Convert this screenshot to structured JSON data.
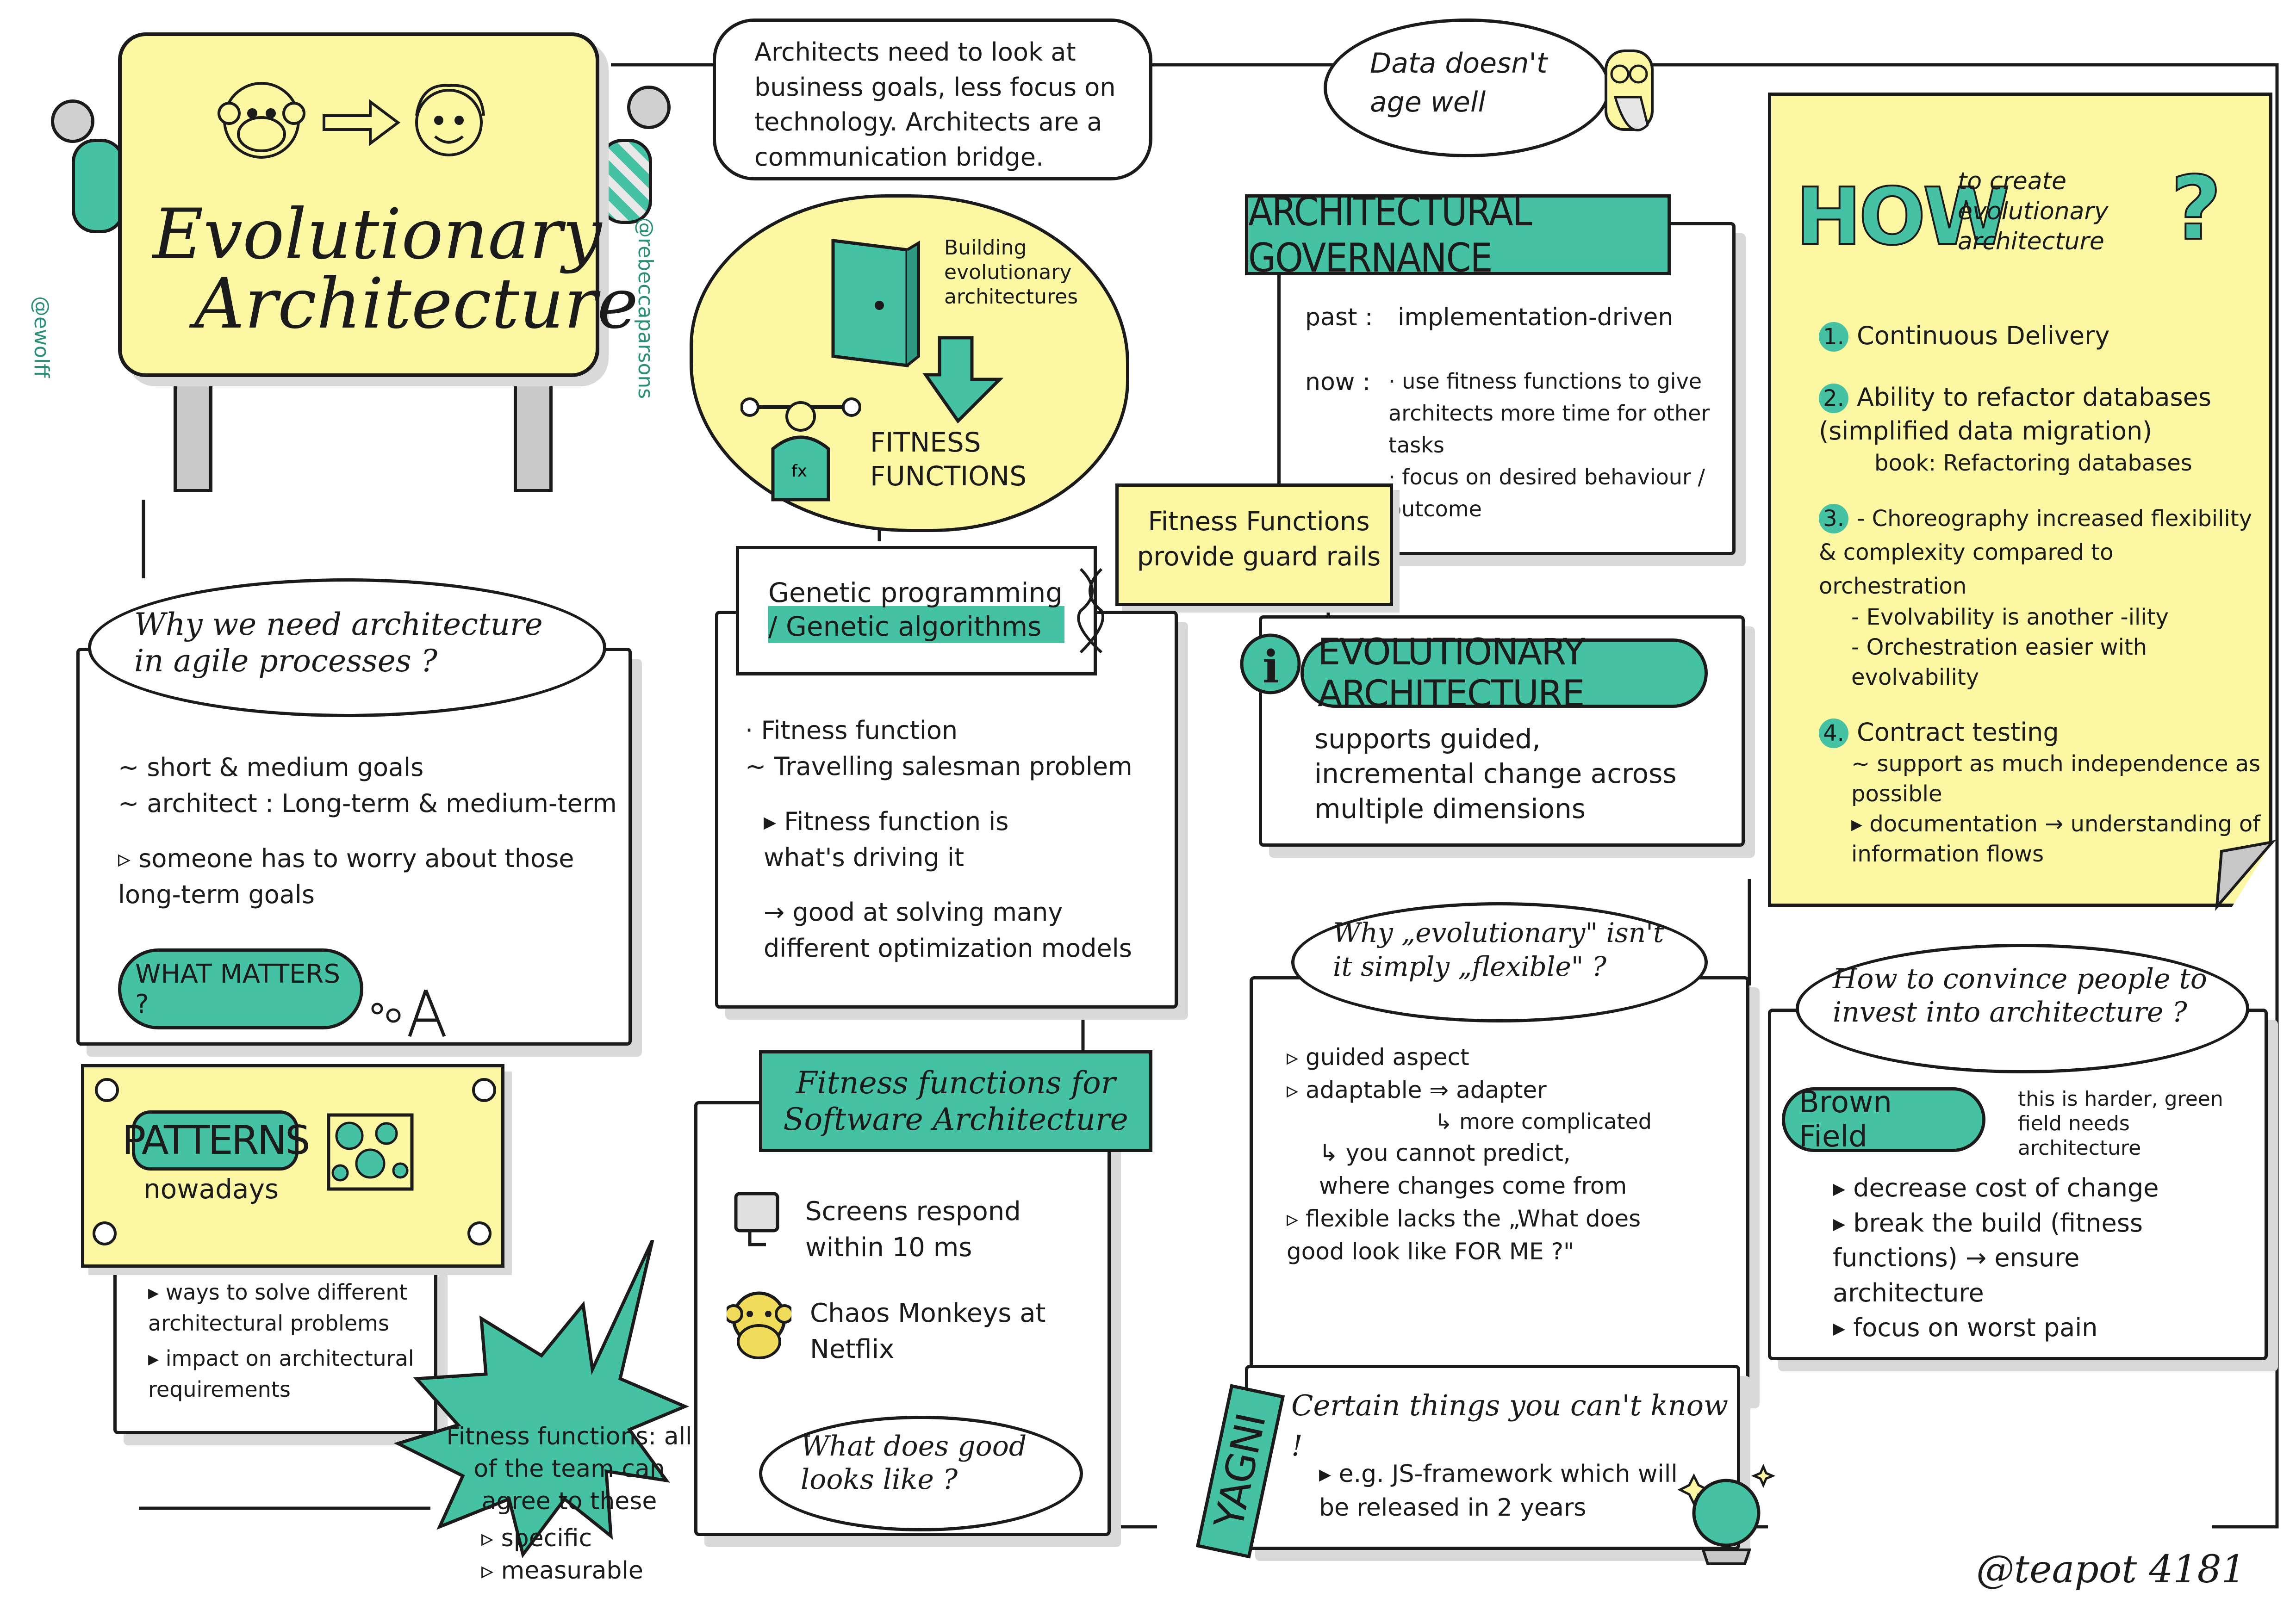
{
  "colors": {
    "teal": "#45c1a3",
    "yellow": "#fbf7a3",
    "ink": "#1b1b1b",
    "shadow": "#d9d9d9"
  },
  "sign": {
    "title_line1": "Evolutionary",
    "title_line2": "Architecture",
    "left_handle": "@ewolff",
    "right_handle": "@rebeccaparsons",
    "icons": [
      "monkey-icon",
      "arrow-icon",
      "person-icon"
    ]
  },
  "quote_architects": "Architects need to look at business goals, less focus on technology. Architects are a communication bridge.",
  "quote_data": "Data doesn't age well",
  "book_cloud": {
    "book_label": "Building evolutionary architectures",
    "fitness_label": "FITNESS FUNCTIONS"
  },
  "governance": {
    "title": "ARCHITECTURAL GOVERNANCE",
    "past_label": "past :",
    "past_value": "implementation-driven",
    "now_label": "now :",
    "now_items": [
      "· use fitness functions to give architects more time for other tasks",
      "· focus on desired behaviour / outcome"
    ],
    "sticky": "Fitness Functions provide guard rails"
  },
  "how": {
    "how": "HOW",
    "subtitle": "to create evolutionary architecture",
    "q": "?",
    "items": [
      {
        "n": "1.",
        "text": "Continuous Delivery",
        "sub": []
      },
      {
        "n": "2.",
        "text": "Ability to refactor databases (simplified data migration)",
        "sub": [
          "book: Refactoring databases"
        ]
      },
      {
        "n": "3.",
        "text": "- Choreography increased flexibility & complexity compared to orchestration",
        "sub": [
          "- Evolvability is another -ility",
          "- Orchestration easier with evolvability"
        ]
      },
      {
        "n": "4.",
        "text": "Contract testing",
        "sub": [
          "~ support as much independence as possible",
          "▸ documentation → understanding of information flows"
        ]
      }
    ]
  },
  "why_agile": {
    "bubble": "Why we need architecture in agile processes ?",
    "items": [
      "~ short & medium goals",
      "~ architect : Long-term & medium-term",
      "▹ someone has to worry about those long-term goals"
    ],
    "tag": "WHAT MATTERS ?"
  },
  "genetic": {
    "tag": "Genetic programming / Genetic algorithms",
    "items": [
      "· Fitness function",
      "~ Travelling salesman problem",
      "▸ Fitness function is what's driving it",
      "→ good at solving many different optimization models"
    ]
  },
  "evo": {
    "title": "EVOLUTIONARY ARCHITECTURE",
    "text": "supports guided, incremental change across multiple dimensions"
  },
  "patterns": {
    "title": "PATTERNS",
    "sub": "nowadays",
    "items": [
      "▸ ways to solve different architectural problems",
      "▸ impact on architectural requirements"
    ]
  },
  "sa_fitness": {
    "banner": "Fitness functions for Software Architecture",
    "items": [
      "Screens respond within 10 ms",
      "Chaos Monkeys at Netflix"
    ],
    "quote": "What does good looks like ?"
  },
  "star": {
    "text": "Fitness functions: all of the team can agree to these",
    "items": [
      "▹ specific",
      "▹ measurable"
    ]
  },
  "why_evo": {
    "bubble": "Why „evolutionary\" isn't it simply „flexible\" ?",
    "items": [
      "▹ guided aspect",
      "▹ adaptable ⇒ adapter",
      "↳ more complicated",
      "↳ you cannot predict, where changes come from",
      "▹ flexible lacks the „What does good look like FOR ME ?\""
    ]
  },
  "convince": {
    "bubble": "How to convince people to invest into architecture ?",
    "tag": "Brown Field",
    "note": "this is harder, green field needs architecture",
    "items": [
      "▸ decrease cost of change",
      "▸ break the build (fitness functions) → ensure architecture",
      "▸ focus on worst pain"
    ]
  },
  "yagni": {
    "label": "YAGNI",
    "title": "Certain things you can't know !",
    "text": "▸ e.g. JS-framework which will be released in 2 years"
  },
  "author": "@teapot 4181"
}
